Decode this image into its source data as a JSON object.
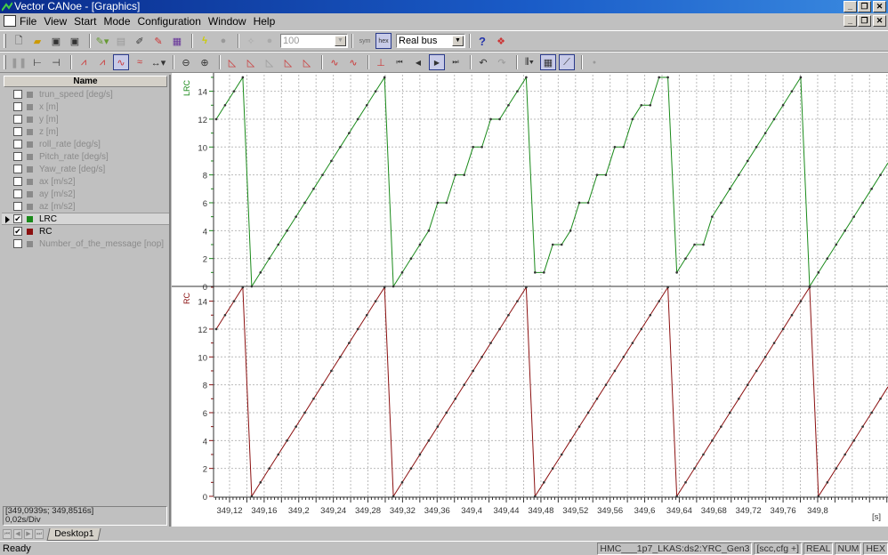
{
  "window": {
    "title": "Vector CANoe  - [Graphics]"
  },
  "menu": [
    "File",
    "View",
    "Start",
    "Mode",
    "Configuration",
    "Window",
    "Help"
  ],
  "toolbar1": {
    "icons": [
      "new-icon",
      "open-icon",
      "save-icon",
      "save-all-icon",
      "configure-icon",
      "panel-icon",
      "edit-icon",
      "paint-icon",
      "calendar-icon",
      "start-lightning-icon",
      "stop-icon",
      "step-icon",
      "zoom-disabled-icon"
    ],
    "rate_value": "100",
    "sym_label": "sym",
    "hex_label": "hex",
    "bus_mode": "Real bus",
    "help_label": "?"
  },
  "toolbar2": {
    "icons": [
      "pause-icon",
      "fit-icon",
      "fit-all-icon",
      "graph-mode-1-icon",
      "graph-mode-2-icon",
      "line-mode-icon",
      "wave-mode-icon",
      "measure-icon",
      "zoom-out-icon",
      "zoom-in-icon",
      "axis-1-icon",
      "axis-2-icon",
      "axis-3-icon",
      "axis-4-icon",
      "axis-5-icon",
      "signal-up-icon",
      "signal-down-icon",
      "marker-icon",
      "first-icon",
      "prev-icon",
      "play-icon",
      "last-icon",
      "undo-icon",
      "redo-icon",
      "columns-icon",
      "grid-icon",
      "cursor-icon",
      "record-dot-icon"
    ]
  },
  "signals": {
    "header": "Name",
    "items": [
      {
        "label": "trun_speed [deg/s]",
        "checked": false,
        "color": "#8a8a8a"
      },
      {
        "label": "x [m]",
        "checked": false,
        "color": "#8a8a8a"
      },
      {
        "label": "y [m]",
        "checked": false,
        "color": "#8a8a8a"
      },
      {
        "label": "z [m]",
        "checked": false,
        "color": "#8a8a8a"
      },
      {
        "label": "roll_rate [deg/s]",
        "checked": false,
        "color": "#8a8a8a"
      },
      {
        "label": "Pitch_rate [deg/s]",
        "checked": false,
        "color": "#8a8a8a"
      },
      {
        "label": "Yaw_rate [deg/s]",
        "checked": false,
        "color": "#8a8a8a"
      },
      {
        "label": "ax [m/s2]",
        "checked": false,
        "color": "#8a8a8a"
      },
      {
        "label": "ay [m/s2]",
        "checked": false,
        "color": "#8a8a8a"
      },
      {
        "label": "az [m/s2]",
        "checked": false,
        "color": "#8a8a8a"
      },
      {
        "label": "LRC",
        "checked": true,
        "color": "#1a8a1a",
        "selected": true
      },
      {
        "label": "RC",
        "checked": true,
        "color": "#8b1010"
      },
      {
        "label": "Number_of_the_message [nop]",
        "checked": false,
        "color": "#8a8a8a"
      }
    ],
    "range": "[349,0939s; 349,8516s]",
    "division": "0,02s/Div"
  },
  "tabs": {
    "active": "Desktop1"
  },
  "status": {
    "text": "Ready",
    "panels": [
      "HMC___1p7_LKAS:ds2:YRC_Gen3",
      "[scc,cfg +]",
      "REAL",
      "NUM",
      "HEX"
    ]
  },
  "chart_data": {
    "type": "line",
    "x_unit": "[s]",
    "x_ticks": [
      "349,12",
      "349,16",
      "349,2",
      "349,24",
      "349,28",
      "349,32",
      "349,36",
      "349,4",
      "349,44",
      "349,48",
      "349,52",
      "349,56",
      "349,6",
      "349,64",
      "349,68",
      "349,72",
      "349,76",
      "349,8"
    ],
    "x_tick_values": [
      349.12,
      349.16,
      349.2,
      349.24,
      349.28,
      349.32,
      349.36,
      349.4,
      349.44,
      349.48,
      349.52,
      349.56,
      349.6,
      349.64,
      349.68,
      349.72,
      349.76,
      349.8
    ],
    "grid": true,
    "x": [
      349.1046,
      349.1148,
      349.1251,
      349.1353,
      349.1456,
      349.1558,
      349.166,
      349.1763,
      349.1865,
      349.1968,
      349.207,
      349.2172,
      349.2275,
      349.2377,
      349.248,
      349.2582,
      349.2684,
      349.2787,
      349.2889,
      349.2992,
      349.3094,
      349.3196,
      349.3299,
      349.3401,
      349.3504,
      349.3606,
      349.3708,
      349.3811,
      349.3913,
      349.4016,
      349.4118,
      349.422,
      349.4323,
      349.4425,
      349.4528,
      349.463,
      349.4732,
      349.4835,
      349.4937,
      349.504,
      349.5142,
      349.5244,
      349.5347,
      349.5449,
      349.5552,
      349.5654,
      349.5756,
      349.5859,
      349.5961,
      349.6064,
      349.6166,
      349.6268,
      349.6371,
      349.6473,
      349.6576,
      349.6678,
      349.678,
      349.6883,
      349.6985,
      349.7088,
      349.719,
      349.7292,
      349.7395,
      349.7497,
      349.76,
      349.7702,
      349.7804,
      349.7907,
      349.8009,
      349.8112,
      349.8214,
      349.8316,
      349.8419,
      349.8521,
      349.8624,
      349.8726
    ],
    "series": [
      {
        "name": "LRC",
        "color": "#1a8a1a",
        "ylim": [
          0,
          15
        ],
        "y_ticks": [
          "0",
          "2",
          "4",
          "6",
          "8",
          "10",
          "12",
          "14"
        ],
        "values": [
          12,
          13,
          14,
          15,
          0,
          1,
          2,
          3,
          4,
          5,
          6,
          7,
          8,
          9,
          10,
          11,
          12,
          13,
          14,
          15,
          0,
          1,
          2,
          3,
          4,
          6,
          6,
          8,
          8,
          10,
          10,
          12,
          12,
          13,
          14,
          15,
          1,
          1,
          3,
          3,
          4,
          6,
          6,
          8,
          8,
          10,
          10,
          12,
          13,
          13,
          15,
          15,
          1,
          2,
          3,
          3,
          5,
          6,
          7,
          8,
          9,
          10,
          11,
          12,
          13,
          14,
          15,
          0,
          1,
          2,
          3,
          4,
          5,
          6,
          7,
          8
        ]
      },
      {
        "name": "RC",
        "color": "#8b1010",
        "ylim": [
          0,
          15
        ],
        "y_ticks": [
          "0",
          "2",
          "4",
          "6",
          "8",
          "10",
          "12",
          "14"
        ],
        "values": [
          12,
          13,
          14,
          15,
          0,
          1,
          2,
          3,
          4,
          5,
          6,
          7,
          8,
          9,
          10,
          11,
          12,
          13,
          14,
          15,
          0,
          1,
          2,
          3,
          4,
          5,
          6,
          7,
          8,
          9,
          10,
          11,
          12,
          13,
          14,
          15,
          0,
          1,
          2,
          3,
          4,
          5,
          6,
          7,
          8,
          9,
          10,
          11,
          12,
          13,
          14,
          15,
          0,
          1,
          2,
          3,
          4,
          5,
          6,
          7,
          8,
          9,
          10,
          11,
          12,
          13,
          14,
          15,
          0,
          1,
          2,
          3,
          4,
          5,
          6,
          7
        ]
      }
    ]
  }
}
